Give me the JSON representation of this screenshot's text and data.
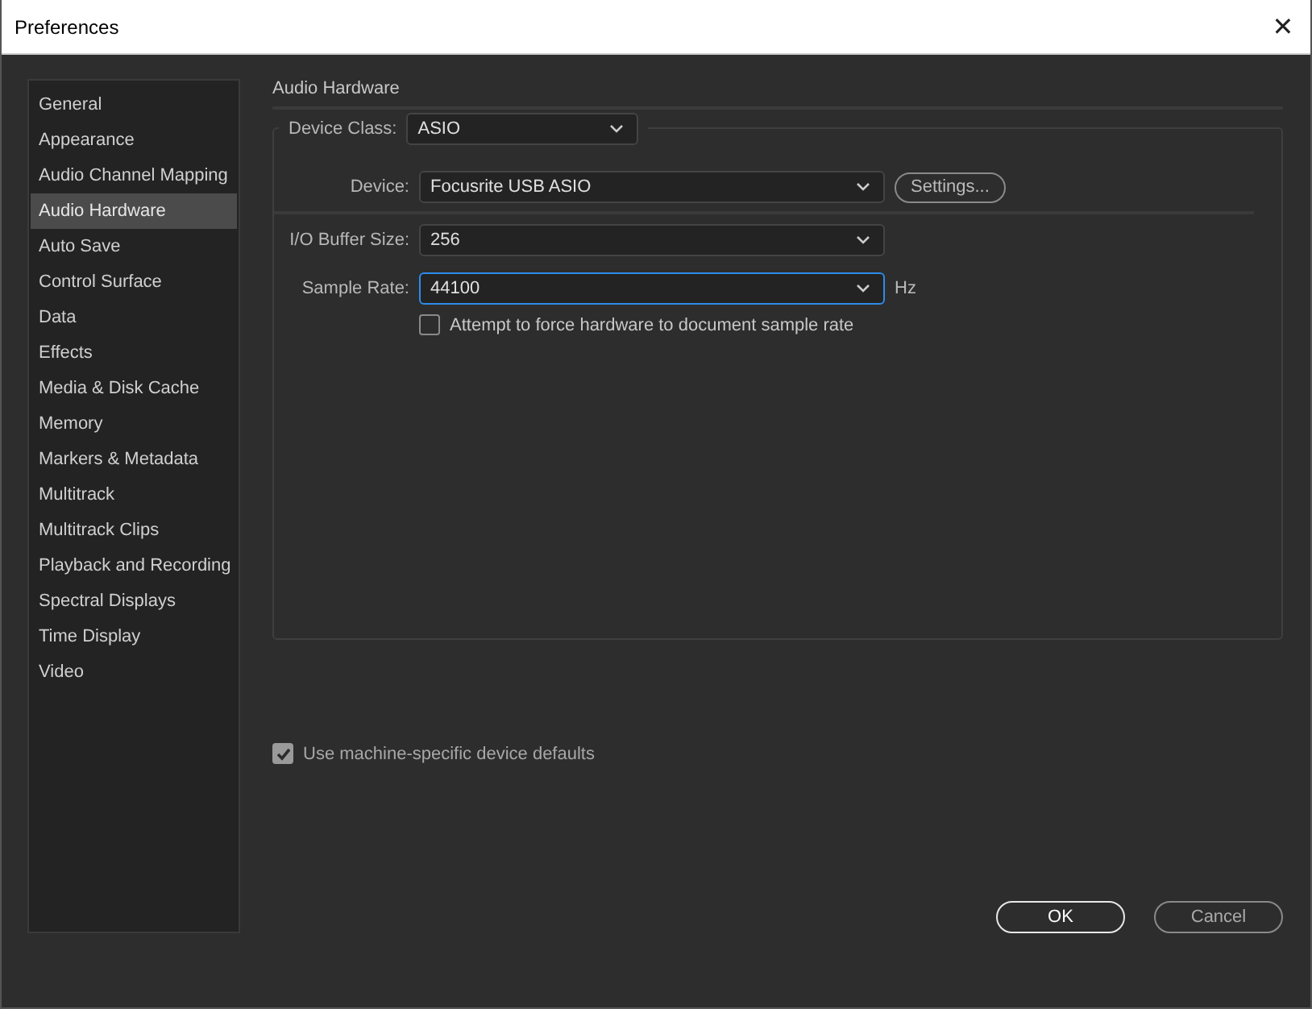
{
  "window": {
    "title": "Preferences",
    "close": "✕"
  },
  "sidebar": {
    "items": [
      {
        "label": "General",
        "selected": false
      },
      {
        "label": "Appearance",
        "selected": false
      },
      {
        "label": "Audio Channel Mapping",
        "selected": false
      },
      {
        "label": "Audio Hardware",
        "selected": true
      },
      {
        "label": "Auto Save",
        "selected": false
      },
      {
        "label": "Control Surface",
        "selected": false
      },
      {
        "label": "Data",
        "selected": false
      },
      {
        "label": "Effects",
        "selected": false
      },
      {
        "label": "Media & Disk Cache",
        "selected": false
      },
      {
        "label": "Memory",
        "selected": false
      },
      {
        "label": "Markers & Metadata",
        "selected": false
      },
      {
        "label": "Multitrack",
        "selected": false
      },
      {
        "label": "Multitrack Clips",
        "selected": false
      },
      {
        "label": "Playback and Recording",
        "selected": false
      },
      {
        "label": "Spectral Displays",
        "selected": false
      },
      {
        "label": "Time Display",
        "selected": false
      },
      {
        "label": "Video",
        "selected": false
      }
    ]
  },
  "section_title": "Audio Hardware",
  "device_class": {
    "label": "Device Class:",
    "value": "ASIO"
  },
  "device": {
    "label": "Device:",
    "value": "Focusrite USB ASIO",
    "button": "Settings..."
  },
  "buffer": {
    "label": "I/O Buffer Size:",
    "value": "256",
    "focused": false
  },
  "sample_rate": {
    "label": "Sample Rate:",
    "value": "44100",
    "focused": true,
    "unit": "Hz"
  },
  "force_rate": {
    "label": "Attempt to force hardware to document sample rate",
    "checked": false
  },
  "machine_defaults": {
    "label": "Use machine-specific device defaults",
    "checked": true,
    "disabled": true
  },
  "buttons": [
    {
      "label": "OK",
      "kind": "primary"
    },
    {
      "label": "Cancel",
      "kind": "secondary"
    }
  ]
}
